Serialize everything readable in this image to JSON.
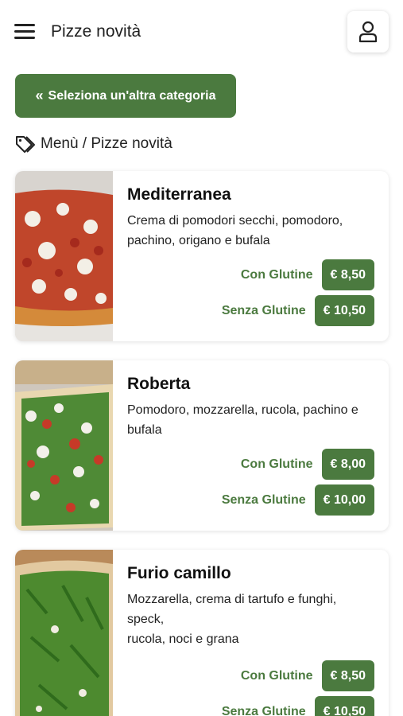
{
  "header": {
    "title": "Pizze novità",
    "menu_icon": "hamburger-icon",
    "user_icon": "user-icon"
  },
  "category_button": {
    "label": "Seleziona un'altra categoria",
    "icon": "double-chevron-left-icon"
  },
  "breadcrumb": {
    "icon": "tags-icon",
    "text": "Menù / Pizze novità"
  },
  "accent_color": "#4b7a3f",
  "products": [
    {
      "name": "Mediterranea",
      "description": "Crema di pomodori secchi, pomodoro, pachino, origano e bufala",
      "prices": [
        {
          "label": "Con Glutine",
          "price": "€ 8,50"
        },
        {
          "label": "Senza Glutine",
          "price": "€ 10,50"
        }
      ]
    },
    {
      "name": "Roberta",
      "description": "Pomodoro, mozzarella, rucola, pachino e bufala",
      "prices": [
        {
          "label": "Con Glutine",
          "price": "€ 8,00"
        },
        {
          "label": "Senza Glutine",
          "price": "€ 10,00"
        }
      ]
    },
    {
      "name": "Furio camillo",
      "description": "Mozzarella, crema di tartufo e funghi, speck,",
      "description_2": "rucola, noci e grana",
      "prices": [
        {
          "label": "Con Glutine",
          "price": "€ 8,50"
        },
        {
          "label": "Senza Glutine",
          "price": "€ 10,50"
        }
      ]
    }
  ]
}
